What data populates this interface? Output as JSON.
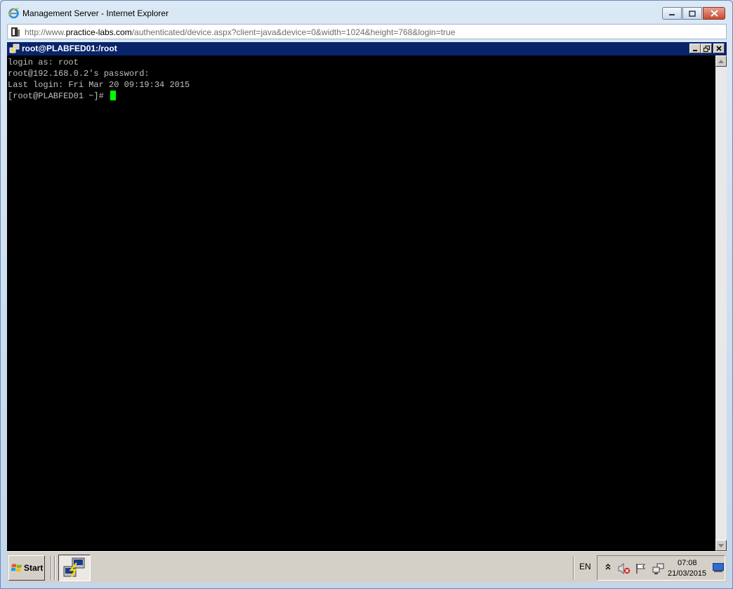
{
  "browser": {
    "title": "Management Server - Internet Explorer",
    "address": {
      "prefix": "http://www.",
      "domain": "practice-labs.com",
      "suffix": "/authenticated/device.aspx?client=java&device=0&width=1024&height=768&login=true"
    }
  },
  "putty": {
    "title": "root@PLABFED01:/root",
    "lines": [
      "login as: root",
      "root@192.168.0.2's password:",
      "Last login: Fri Mar 20 09:19:34 2015",
      "[root@PLABFED01 ~]# "
    ],
    "cursor_color": "#00ff00"
  },
  "taskbar": {
    "start_label": "Start",
    "language": "EN",
    "clock_time": "07:08",
    "clock_date": "21/03/2015",
    "tray_icons": [
      "chevron-up-icon",
      "volume-muted-icon",
      "flag-icon",
      "network-icon"
    ]
  },
  "colors": {
    "titlebar": "#0a246a",
    "terminal_bg": "#000000",
    "terminal_text": "#c0c0c0"
  }
}
